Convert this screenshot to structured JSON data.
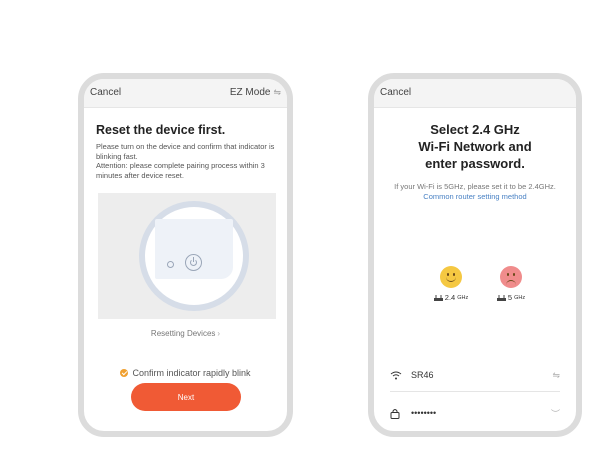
{
  "left": {
    "cancel_label": "Cancel",
    "mode_label": "EZ Mode",
    "mode_icon": "swap-icon",
    "title": "Reset the device first.",
    "description": "Please turn on the device and confirm that indicator is blinking fast.",
    "attention": "Attention: please complete pairing process within 3 minutes after device reset.",
    "resetting_link": "Resetting Devices",
    "confirm_label": "Confirm indicator rapidly blink",
    "next_label": "Next",
    "colors": {
      "accent": "#f05a35",
      "check": "#f0a030"
    }
  },
  "right": {
    "cancel_label": "Cancel",
    "title_lines": [
      "Select 2.4 GHz",
      "Wi-Fi Network and",
      "enter password."
    ],
    "hint_text": "If your Wi-Fi is 5GHz, please set it to be 2.4GHz.",
    "hint_link": "Common router setting method",
    "bands": [
      {
        "face": "happy-face-icon",
        "freq": "2.4",
        "unit": "GHz",
        "color": "#f5c842"
      },
      {
        "face": "sad-face-icon",
        "freq": "5",
        "unit": "GHz",
        "color": "#f08c8c"
      }
    ],
    "ssid": "SR46",
    "password_mask": "••••••••",
    "link_color": "#4a82c4"
  }
}
